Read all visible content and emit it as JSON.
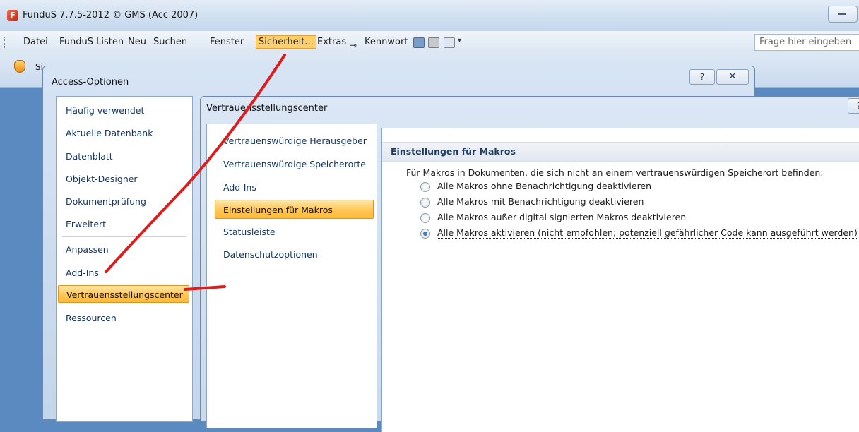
{
  "window": {
    "title": "FunduS  7.7.5-2012 © GMS (Acc 2007)"
  },
  "menubar": {
    "items": [
      "Datei",
      "FunduS Listen",
      "Neu",
      "Suchen",
      "Fenster",
      "Sicherheit...",
      "Extras",
      "Kennwort"
    ],
    "selected": "Sicherheit...",
    "ask_placeholder": "Frage hier eingeben"
  },
  "ribbon": {
    "text": "Si"
  },
  "access_options": {
    "title": "Access-Optionen",
    "help_label": "?",
    "close_label": "✕",
    "nav": [
      "Häufig verwendet",
      "Aktuelle Datenbank",
      "Datenblatt",
      "Objekt-Designer",
      "Dokumentprüfung",
      "Erweitert",
      "Anpassen",
      "Add-Ins",
      "Vertrauensstellungscenter",
      "Ressourcen"
    ],
    "selected": "Vertrauensstellungscenter"
  },
  "trust_center": {
    "title": "Vertrauensstellungscenter",
    "help_label": "?",
    "nav": [
      "Vertrauenswürdige Herausgeber",
      "Vertrauenswürdige Speicherorte",
      "Add-Ins",
      "Einstellungen für Makros",
      "Statusleiste",
      "Datenschutzoptionen"
    ],
    "selected": "Einstellungen für Makros",
    "section_title": "Einstellungen für Makros",
    "intro": "Für Makros in Dokumenten, die sich nicht an einem vertrauenswürdigen Speicherort befinden:",
    "options": [
      "Alle Makros ohne Benachrichtigung deaktivieren",
      "Alle Makros mit Benachrichtigung deaktivieren",
      "Alle Makros außer digital signierten Makros deaktivieren",
      "Alle Makros aktivieren (nicht empfohlen; potenziell gefährlicher Code kann ausgeführt werden)"
    ],
    "selected_option_index": 3
  },
  "colors": {
    "selection": "#ffc655",
    "annotation": "#e01b1b"
  }
}
